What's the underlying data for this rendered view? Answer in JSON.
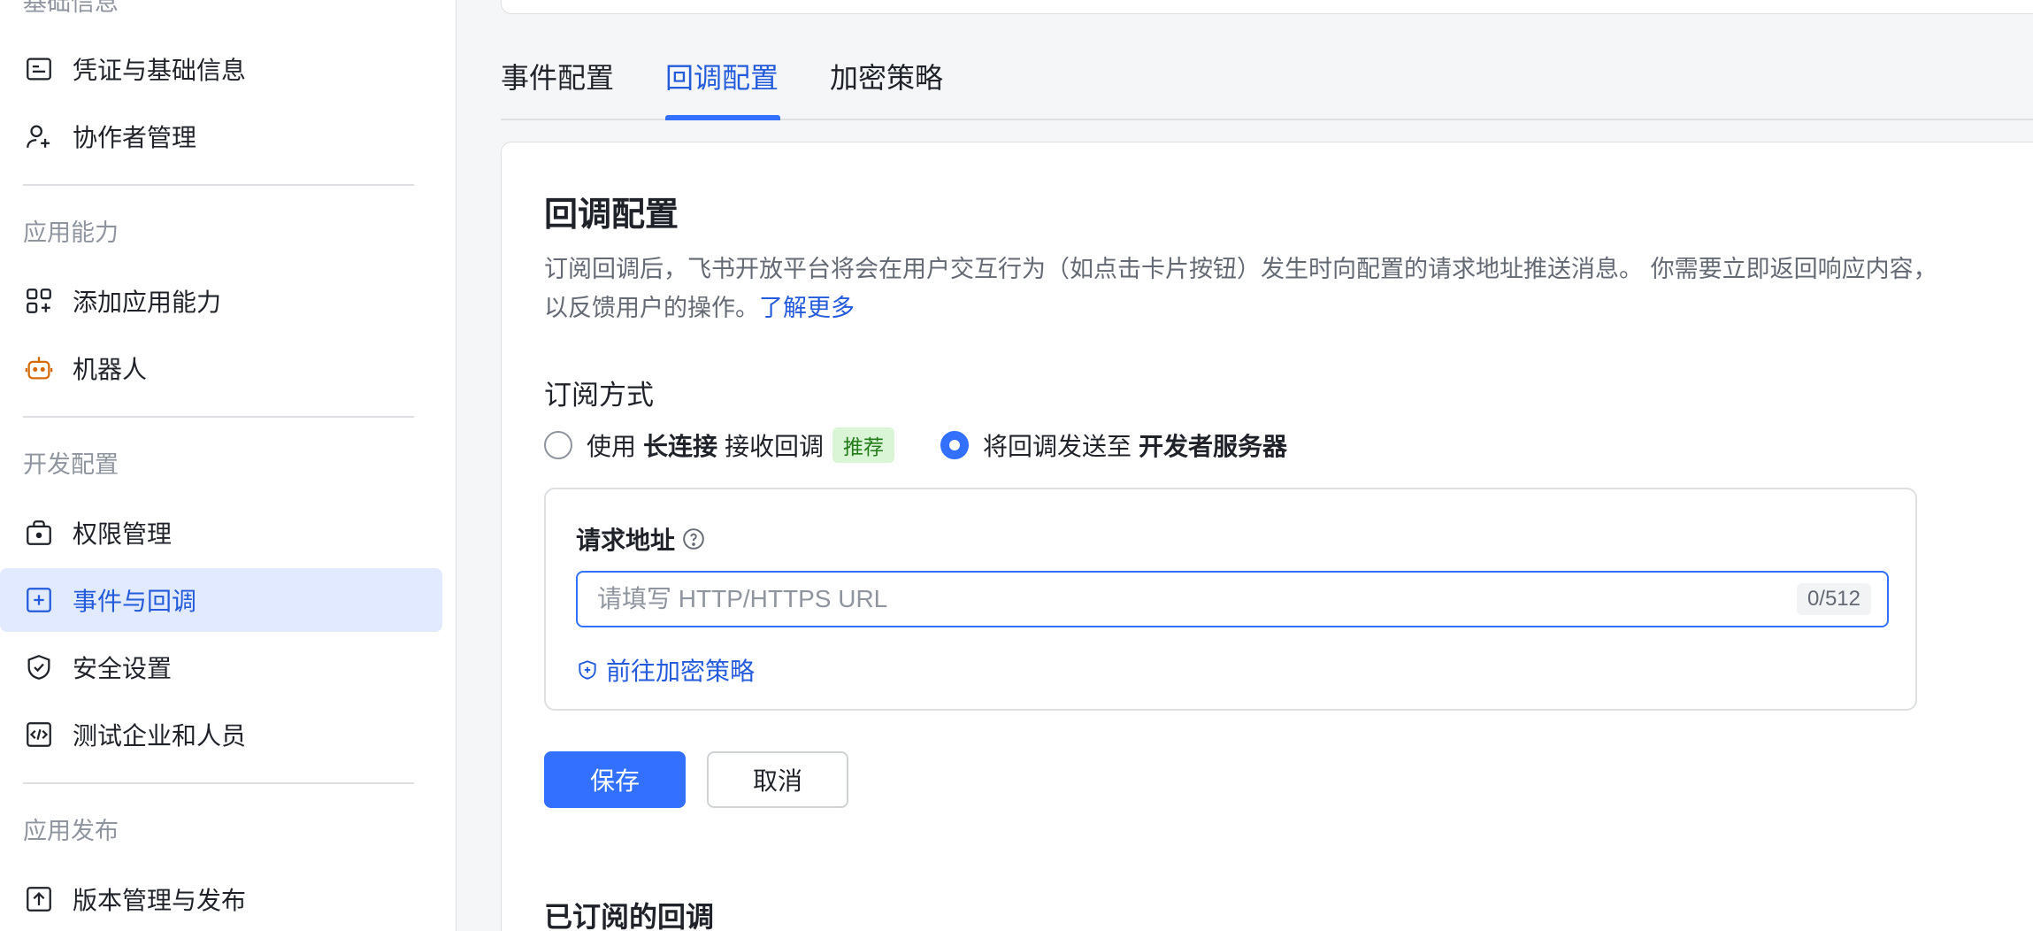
{
  "sidebar": {
    "top_section_title": "基础信息",
    "basic_items": [
      {
        "label": "凭证与基础信息",
        "icon": "credential-card-icon"
      },
      {
        "label": "协作者管理",
        "icon": "user-add-icon"
      }
    ],
    "ability_section_title": "应用能力",
    "ability_items": [
      {
        "label": "添加应用能力",
        "icon": "apps-add-icon"
      },
      {
        "label": "机器人",
        "icon": "robot-icon"
      }
    ],
    "dev_section_title": "开发配置",
    "dev_items": [
      {
        "label": "权限管理",
        "icon": "permission-briefcase-icon"
      },
      {
        "label": "事件与回调",
        "icon": "event-callback-icon",
        "active": true
      },
      {
        "label": "安全设置",
        "icon": "shield-check-icon"
      },
      {
        "label": "测试企业和人员",
        "icon": "code-test-icon"
      }
    ],
    "publish_section_title": "应用发布",
    "publish_items": [
      {
        "label": "版本管理与发布",
        "icon": "upload-icon"
      }
    ]
  },
  "tabs": [
    {
      "label": "事件配置",
      "active": false
    },
    {
      "label": "回调配置",
      "active": true
    },
    {
      "label": "加密策略",
      "active": false
    }
  ],
  "panel": {
    "title": "回调配置",
    "description": "订阅回调后，飞书开放平台将会在用户交互行为（如点击卡片按钮）发生时向配置的请求地址推送消息。 你需要立即返回响应内容，以反馈用户的操作。",
    "learn_more": "了解更多",
    "mode_title": "订阅方式",
    "option_long_conn": {
      "prefix": "使用",
      "bold": "长连接",
      "suffix": "接收回调",
      "badge": "推荐",
      "checked": false
    },
    "option_server": {
      "prefix": "将回调发送至",
      "bold": "开发者服务器",
      "checked": true
    },
    "url_label": "请求地址",
    "url_placeholder": "请填写 HTTP/HTTPS URL",
    "url_value": "",
    "char_count": "0/512",
    "enc_link": "前往加密策略",
    "save_label": "保存",
    "cancel_label": "取消",
    "subscribed_title": "已订阅的回调"
  },
  "colors": {
    "accent": "#3370ff",
    "active_bg": "#e1eaff",
    "badge_bg": "#d9f5d6",
    "badge_text": "#237b19",
    "robot_icon": "#d46b08"
  }
}
